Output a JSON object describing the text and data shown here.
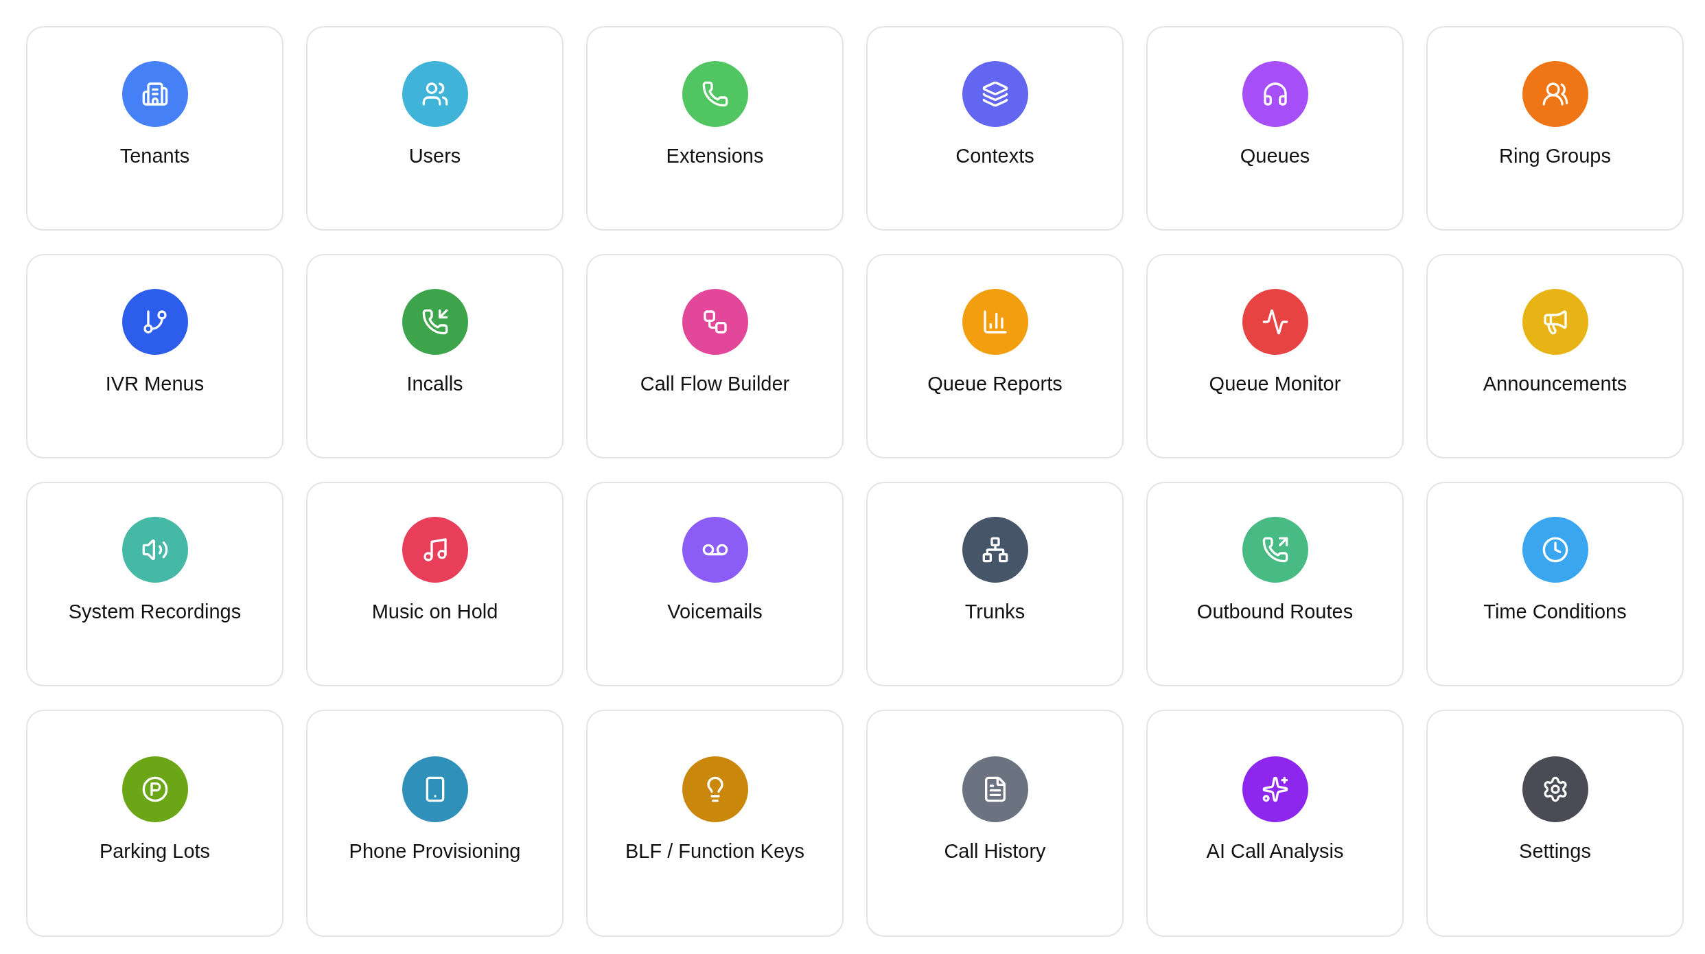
{
  "items": [
    {
      "label": "Tenants",
      "color": "#4680f6"
    },
    {
      "label": "Users",
      "color": "#40b4d8"
    },
    {
      "label": "Extensions",
      "color": "#50c562"
    },
    {
      "label": "Contexts",
      "color": "#6366f1"
    },
    {
      "label": "Queues",
      "color": "#a64ef8"
    },
    {
      "label": "Ring Groups",
      "color": "#f07515"
    },
    {
      "label": "IVR Menus",
      "color": "#2d5eeb"
    },
    {
      "label": "Incalls",
      "color": "#3ea44c"
    },
    {
      "label": "Call Flow Builder",
      "color": "#e3479a"
    },
    {
      "label": "Queue Reports",
      "color": "#f29e0f"
    },
    {
      "label": "Queue Monitor",
      "color": "#e84343"
    },
    {
      "label": "Announcements",
      "color": "#e8b415"
    },
    {
      "label": "System Recordings",
      "color": "#45b8a6"
    },
    {
      "label": "Music on Hold",
      "color": "#e83e5a"
    },
    {
      "label": "Voicemails",
      "color": "#8b5cf6"
    },
    {
      "label": "Trunks",
      "color": "#475569"
    },
    {
      "label": "Outbound Routes",
      "color": "#48bb84"
    },
    {
      "label": "Time Conditions",
      "color": "#3ba6f0"
    },
    {
      "label": "Parking Lots",
      "color": "#6aa616"
    },
    {
      "label": "Phone Provisioning",
      "color": "#2f91b9"
    },
    {
      "label": "BLF / Function Keys",
      "color": "#c9880b"
    },
    {
      "label": "Call History",
      "color": "#6b7280"
    },
    {
      "label": "AI Call Analysis",
      "color": "#8e27ee"
    },
    {
      "label": "Settings",
      "color": "#4b4b55"
    }
  ]
}
